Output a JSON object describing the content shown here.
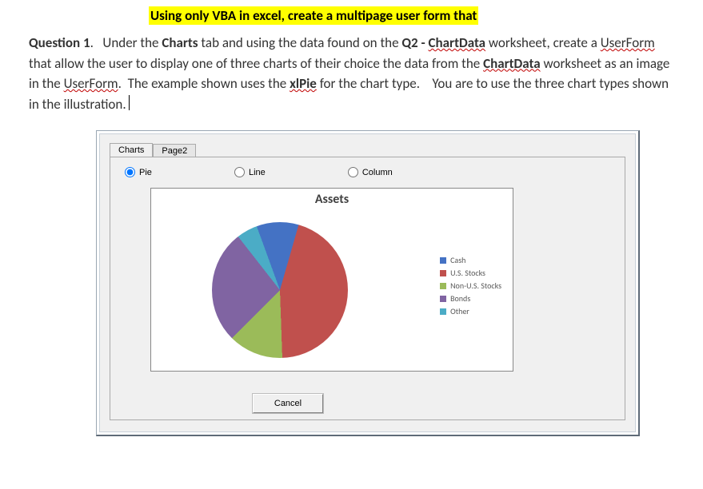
{
  "heading": "Using only VBA in excel, create a multipage user form that",
  "question": {
    "label": "Question 1",
    "t1": ".   Under the ",
    "b1": "Charts",
    "t2": " tab and using the data found on the ",
    "b2": "Q2 - ",
    "b2u": "ChartData",
    "t3": " worksheet, create a ",
    "u1": "UserForm",
    "t4": " that allow the user to display one of three charts of their choice the data from the ",
    "b3u": "ChartData",
    "t5": " worksheet as an image in the ",
    "u2": "UserForm",
    "t6": ".  The example shown uses the ",
    "b4u": "xlPie",
    "t7": " for the chart type.    You are to use the three chart types shown in the illustration. "
  },
  "form": {
    "tabs": [
      "Charts",
      "Page2"
    ],
    "activeTab": 0,
    "radios": [
      {
        "label": "Pie",
        "checked": true
      },
      {
        "label": "Line",
        "checked": false
      },
      {
        "label": "Column",
        "checked": false
      }
    ],
    "cancelLabel": "Cancel"
  },
  "chart_data": {
    "type": "pie",
    "title": "Assets",
    "categories": [
      "Cash",
      "U.S. Stocks",
      "Non-U.S. Stocks",
      "Bonds",
      "Other"
    ],
    "values": [
      10,
      45,
      13,
      27,
      5
    ],
    "colors": {
      "Cash": "#4472c4",
      "U.S. Stocks": "#c0504d",
      "Non-U.S. Stocks": "#9bbb59",
      "Bonds": "#8064a2",
      "Other": "#4bacc6"
    }
  }
}
